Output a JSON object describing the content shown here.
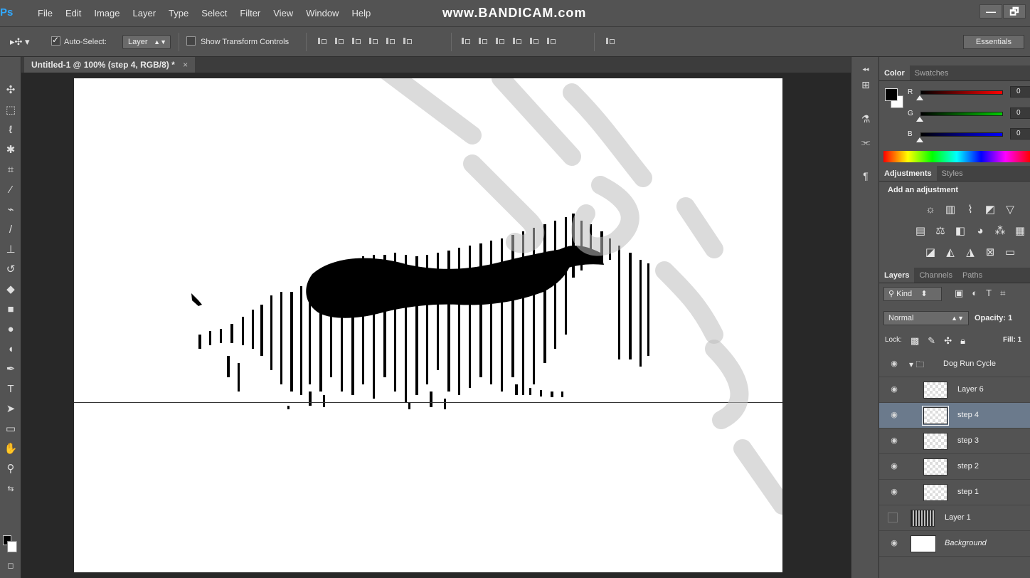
{
  "app": {
    "logo": "Ps"
  },
  "menu": [
    "File",
    "Edit",
    "Image",
    "Layer",
    "Type",
    "Select",
    "Filter",
    "View",
    "Window",
    "Help"
  ],
  "watermark_recorder": "www.BANDICAM.com",
  "window_controls": {
    "minimize": "—",
    "restore": "🗗"
  },
  "options": {
    "auto_select_label": "Auto-Select:",
    "auto_select_checked": true,
    "auto_select_target": "Layer",
    "show_transform_label": "Show Transform Controls",
    "show_transform_checked": false,
    "workspace": "Essentials"
  },
  "document": {
    "tab_title": "Untitled-1 @ 100% (step 4, RGB/8) *",
    "close": "×"
  },
  "color_panel": {
    "tabs": [
      "Color",
      "Swatches"
    ],
    "active_tab": "Color",
    "r": {
      "label": "R",
      "value": "0"
    },
    "g": {
      "label": "G",
      "value": "0"
    },
    "b": {
      "label": "B",
      "value": "0"
    },
    "foreground": "#000000",
    "background": "#ffffff"
  },
  "adjustments_panel": {
    "tabs": [
      "Adjustments",
      "Styles"
    ],
    "active_tab": "Adjustments",
    "title": "Add an adjustment",
    "rows": [
      [
        "brightness-icon",
        "levels-icon",
        "curves-icon",
        "exposure-icon",
        "vibrance-icon"
      ],
      [
        "hue-saturation-icon",
        "color-balance-icon",
        "black-white-icon",
        "photo-filter-icon",
        "channel-mixer-icon",
        "color-lookup-icon"
      ],
      [
        "invert-icon",
        "posterize-icon",
        "threshold-icon",
        "selective-color-icon",
        "gradient-map-icon"
      ]
    ]
  },
  "layers_panel": {
    "tabs": [
      "Layers",
      "Channels",
      "Paths"
    ],
    "active_tab": "Layers",
    "kind_label": "Kind",
    "blend_mode": "Normal",
    "opacity_label": "Opacity:",
    "opacity_value": "1",
    "lock_label": "Lock:",
    "fill_label": "Fill:",
    "fill_value": "1",
    "layers": [
      {
        "name": "Dog Run Cycle",
        "type": "group",
        "visible": true,
        "selected": false
      },
      {
        "name": "Layer 6",
        "type": "layer",
        "visible": true,
        "selected": false
      },
      {
        "name": "step 4",
        "type": "layer",
        "visible": true,
        "selected": true
      },
      {
        "name": "step 3",
        "type": "layer",
        "visible": true,
        "selected": false
      },
      {
        "name": "step 2",
        "type": "layer",
        "visible": true,
        "selected": false
      },
      {
        "name": "step 1",
        "type": "layer",
        "visible": true,
        "selected": false
      },
      {
        "name": "Layer 1",
        "type": "layer",
        "visible": false,
        "selected": false
      },
      {
        "name": "Background",
        "type": "background",
        "visible": true,
        "selected": false
      }
    ]
  },
  "colors": {
    "chrome": "#535353",
    "canvas": "#ffffff",
    "selected_layer": "#6b7a8c",
    "accent": "#31a8ff"
  }
}
